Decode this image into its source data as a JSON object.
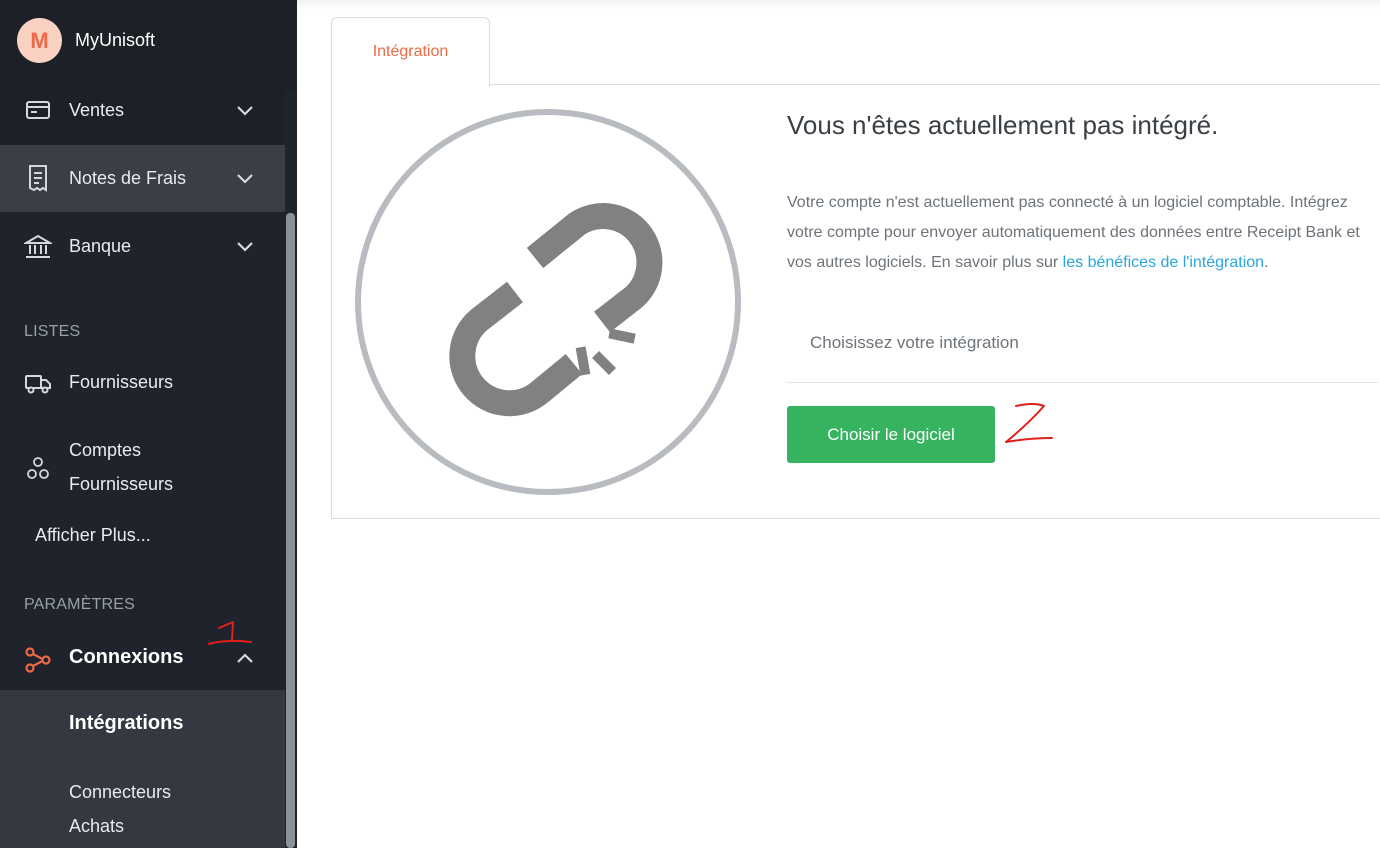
{
  "brand": {
    "avatar_letter": "M",
    "name": "MyUnisoft"
  },
  "sidebar": {
    "items": [
      {
        "label": "Ventes",
        "icon": "card-icon"
      },
      {
        "label": "Notes de Frais",
        "icon": "receipt-icon"
      },
      {
        "label": "Banque",
        "icon": "bank-icon"
      }
    ],
    "lists_heading": "LISTES",
    "lists": [
      {
        "label": "Fournisseurs",
        "icon": "truck-icon"
      },
      {
        "label_line1": "Comptes",
        "label_line2": "Fournisseurs",
        "icon": "accounts-icon"
      }
    ],
    "show_more": "Afficher Plus...",
    "settings_heading": "PARAMÈTRES",
    "connexions": {
      "label": "Connexions",
      "icon": "connections-icon",
      "accent": "#ec6a45"
    },
    "sub_items": [
      {
        "label": "Intégrations"
      },
      {
        "label_line1": "Connecteurs",
        "label_line2": "Achats"
      }
    ]
  },
  "main": {
    "tab_label": "Intégration",
    "heading": "Vous n'êtes actuellement pas intégré.",
    "paragraph_text": "Votre compte n'est actuellement pas connecté à un logiciel comptable. Intégrez votre compte pour envoyer automatiquement des données entre Receipt Bank et vos autres logiciels. En savoir plus sur ",
    "paragraph_link": "les bénéfices de l'intégration",
    "paragraph_end": ".",
    "choose_label": "Choisissez votre intégration",
    "button_label": "Choisir le logiciel",
    "illustration": "broken-link-icon"
  },
  "annotations": {
    "one": "1",
    "two": "2",
    "color": "#e0201b"
  },
  "colors": {
    "sidebar_bg": "#1f232b",
    "accent": "#ec6a45",
    "button": "#35b35e",
    "link": "#2aa5e0"
  }
}
